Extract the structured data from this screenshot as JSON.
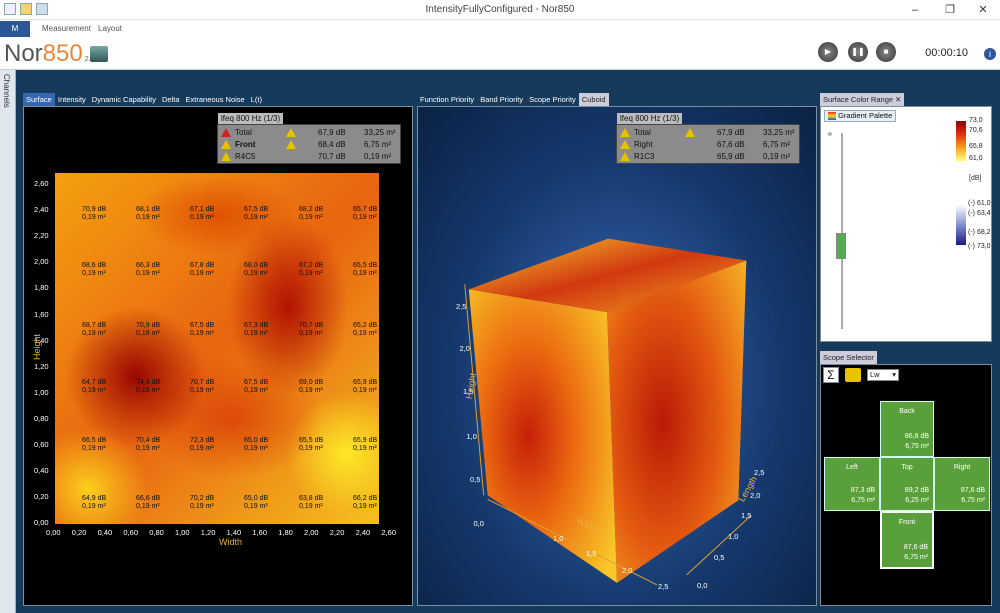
{
  "window": {
    "title": "IntensityFullyConfigured - Nor850",
    "minimize": "–",
    "restore": "❐",
    "close": "✕"
  },
  "ribbon": {
    "file_label": "M",
    "tabs": [
      "Measurement",
      "Layout"
    ]
  },
  "app": {
    "brand_prefix": "Nor",
    "brand_number": "850",
    "version": "2.3",
    "timer": "00:00:10",
    "help": "i"
  },
  "sidebar": {
    "label": "Channels"
  },
  "left_panel": {
    "tabs": [
      "Surface",
      "Intensity",
      "Dynamic Capability",
      "Delta",
      "Extraneous Noise",
      "L(t)"
    ],
    "info": {
      "header": "lfeq 800 Hz (1/3)",
      "rows": [
        {
          "name": "Total",
          "level": "67,9 dB",
          "area": "33,25 m²",
          "status": "error"
        },
        {
          "name": "Front",
          "level": "68,4 dB",
          "area": "6,75 m²",
          "status": "warning"
        },
        {
          "name": "R4C5",
          "level": "70,7 dB",
          "area": "0,19 m²",
          "status": "none"
        }
      ]
    },
    "y_ticks": [
      "2,60",
      "2,40",
      "2,20",
      "2,00",
      "1,80",
      "1,60",
      "1,40",
      "1,20",
      "1,00",
      "0,80",
      "0,60",
      "0,40",
      "0,20",
      "0,00"
    ],
    "x_ticks": [
      "0,00",
      "0,20",
      "0,40",
      "0,60",
      "0,80",
      "1,00",
      "1,20",
      "1,40",
      "1,60",
      "1,80",
      "2,00",
      "2,20",
      "2,40",
      "2,60"
    ],
    "x_label": "Width",
    "y_label": "Height",
    "grid_rows": [
      [
        {
          "db": "70,9 dB",
          "area": "0,19 m²"
        },
        {
          "db": "68,1 dB",
          "area": "0,19 m²"
        },
        {
          "db": "67,1 dB",
          "area": "0,19 m²"
        },
        {
          "db": "67,5 dB",
          "area": "0,19 m²"
        },
        {
          "db": "68,2 dB",
          "area": "0,19 m²"
        },
        {
          "db": "65,7 dB",
          "area": "0,19 m²"
        }
      ],
      [
        {
          "db": "68,6 dB",
          "area": "0,19 m²"
        },
        {
          "db": "66,3 dB",
          "area": "0,19 m²"
        },
        {
          "db": "67,8 dB",
          "area": "0,19 m²"
        },
        {
          "db": "68,0 dB",
          "area": "0,19 m²"
        },
        {
          "db": "67,2 dB",
          "area": "0,19 m²"
        },
        {
          "db": "65,5 dB",
          "area": "0,19 m²"
        }
      ],
      [
        {
          "db": "68,7 dB",
          "area": "0,19 m²"
        },
        {
          "db": "70,9 dB",
          "area": "0,19 m²"
        },
        {
          "db": "67,5 dB",
          "area": "0,19 m²"
        },
        {
          "db": "67,3 dB",
          "area": "0,19 m²"
        },
        {
          "db": "70,7 dB",
          "area": "0,19 m²"
        },
        {
          "db": "65,2 dB",
          "area": "0,19 m²"
        }
      ],
      [
        {
          "db": "64,7 dB",
          "area": "0,19 m²"
        },
        {
          "db": "74,4 dB",
          "area": "0,19 m²"
        },
        {
          "db": "70,7 dB",
          "area": "0,19 m²"
        },
        {
          "db": "67,5 dB",
          "area": "0,19 m²"
        },
        {
          "db": "69,0 dB",
          "area": "0,19 m²"
        },
        {
          "db": "65,9 dB",
          "area": "0,19 m²"
        }
      ],
      [
        {
          "db": "66,5 dB",
          "area": "0,19 m²"
        },
        {
          "db": "70,4 dB",
          "area": "0,19 m²"
        },
        {
          "db": "72,3 dB",
          "area": "0,19 m²"
        },
        {
          "db": "65,0 dB",
          "area": "0,19 m²"
        },
        {
          "db": "65,5 dB",
          "area": "0,19 m²"
        },
        {
          "db": "65,9 dB",
          "area": "0,19 m²"
        }
      ],
      [
        {
          "db": "64,9 dB",
          "area": "0,19 m²"
        },
        {
          "db": "66,6 dB",
          "area": "0,19 m²"
        },
        {
          "db": "70,2 dB",
          "area": "0,19 m²"
        },
        {
          "db": "65,0 dB",
          "area": "0,19 m²"
        },
        {
          "db": "63,8 dB",
          "area": "0,19 m²"
        },
        {
          "db": "66,2 dB",
          "area": "0,19 m²"
        }
      ]
    ]
  },
  "center_panel": {
    "tabs": [
      "Function Priority",
      "Band Priority",
      "Scope Priority",
      "Cuboid"
    ],
    "info": {
      "header": "lfeq 800 Hz (1/3)",
      "rows": [
        {
          "name": "Total",
          "level": "67,9 dB",
          "area": "33,25 m²",
          "status": "warning"
        },
        {
          "name": "Right",
          "level": "67,6 dB",
          "area": "6,75 m²",
          "status": "none"
        },
        {
          "name": "R1C3",
          "level": "65,9 dB",
          "area": "0,19 m²",
          "status": "none"
        }
      ]
    },
    "height_ticks": [
      "2,5",
      "2,0",
      "1,5",
      "1,0",
      "0,5",
      "0,0"
    ],
    "width_ticks": [
      "1,0",
      "1,5",
      "2,0",
      "2,5"
    ],
    "length_ticks": [
      "2,5",
      "2,0",
      "1,5",
      "1,0",
      "0,5",
      "0,0"
    ],
    "labels": {
      "height": "Height",
      "width": "Width",
      "length": "Length"
    }
  },
  "color_range": {
    "tab": "Surface Color Range",
    "close": "✕",
    "palette_label": "Gradient Palette",
    "scale_top": [
      "73,0",
      "70,6",
      "65,8",
      "61,0"
    ],
    "unit": "[dB]",
    "scale_bottom": [
      "(-) 61,0",
      "(-) 63,4",
      "(-) 68,2",
      "(-) 73,0"
    ]
  },
  "scope_selector": {
    "tab": "Scope Selector",
    "sigma": "Σ",
    "dropdown_value": "Lw",
    "faces": {
      "back": {
        "name": "Back",
        "db": "86,8 dB",
        "area": "6,75 m²"
      },
      "left": {
        "name": "Left",
        "db": "87,3 dB",
        "area": "6,75 m²"
      },
      "top": {
        "name": "Top",
        "db": "89,2 dB",
        "area": "6,25 m²"
      },
      "right": {
        "name": "Right",
        "db": "87,6 dB",
        "area": "6,75 m²"
      },
      "front": {
        "name": "Front",
        "db": "87,6 dB",
        "area": "6,75 m²"
      }
    }
  }
}
